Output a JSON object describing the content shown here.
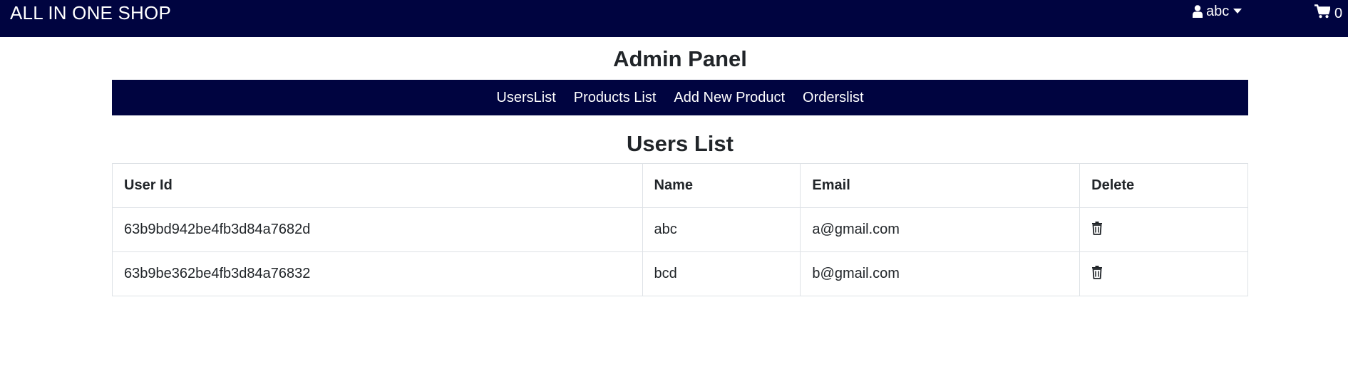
{
  "header": {
    "brand": "ALL IN ONE SHOP",
    "user_name": "abc",
    "cart_count": "0",
    "background_color": "#000440"
  },
  "page_title": "Admin Panel",
  "admin_nav": {
    "items": [
      {
        "label": "UsersList"
      },
      {
        "label": "Products List"
      },
      {
        "label": "Add New Product"
      },
      {
        "label": "Orderslist"
      }
    ]
  },
  "section_title": "Users List",
  "table": {
    "columns": [
      "User Id",
      "Name",
      "Email",
      "Delete"
    ],
    "rows": [
      {
        "id": "63b9bd942be4fb3d84a7682d",
        "name": "abc",
        "email": "a@gmail.com",
        "delete_icon": "trash-icon"
      },
      {
        "id": "63b9be362be4fb3d84a76832",
        "name": "bcd",
        "email": "b@gmail.com",
        "delete_icon": "trash-icon"
      }
    ]
  },
  "icons": {
    "user": "user-icon",
    "cart": "cart-icon",
    "dropdown": "caret-down-icon"
  }
}
